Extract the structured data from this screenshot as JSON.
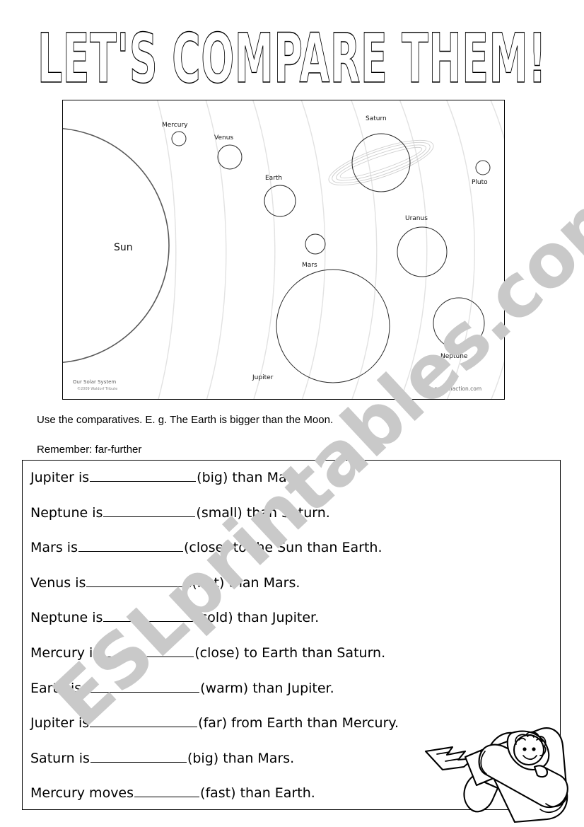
{
  "page": {
    "title": "LET'S COMPARE THEM!",
    "watermark": "ESLprintables.com"
  },
  "figure": {
    "sun_label": "Sun",
    "credit": "Our Solar System",
    "credit_sub": "©2009 Waldorf Tribute",
    "website": "www.crayonaction.com",
    "planets": [
      {
        "name": "Mercury"
      },
      {
        "name": "Venus"
      },
      {
        "name": "Earth"
      },
      {
        "name": "Mars"
      },
      {
        "name": "Jupiter"
      },
      {
        "name": "Saturn"
      },
      {
        "name": "Uranus"
      },
      {
        "name": "Neptune"
      },
      {
        "name": "Pluto"
      }
    ]
  },
  "instructions": {
    "line1": "Use the comparatives. E. g. The Earth is bigger than the Moon.",
    "line2": "Remember: far-further"
  },
  "exercises": [
    {
      "pre": "Jupiter is",
      "blank_width": 150,
      "post": "(big) than Mars."
    },
    {
      "pre": "Neptune is",
      "blank_width": 130,
      "post": "(small) than Saturn."
    },
    {
      "pre": "Mars is ",
      "blank_width": 148,
      "post": "(close) to the Sun than Earth."
    },
    {
      "pre": "Venus is ",
      "blank_width": 148,
      "post": "(hot) than Mars."
    },
    {
      "pre": "Neptune is",
      "blank_width": 128,
      "post": "(cold) than Jupiter."
    },
    {
      "pre": "Mercury is ",
      "blank_width": 132,
      "post": "(close) to Earth than Saturn."
    },
    {
      "pre": "Earth is",
      "blank_width": 166,
      "post": "(warm) than Jupiter."
    },
    {
      "pre": "Jupiter is",
      "blank_width": 152,
      "post": "(far) from Earth than Mercury."
    },
    {
      "pre": "Saturn is ",
      "blank_width": 136,
      "post": "(big) than Mars."
    },
    {
      "pre": "Mercury moves",
      "blank_width": 92,
      "post": "(fast) than Earth."
    }
  ]
}
